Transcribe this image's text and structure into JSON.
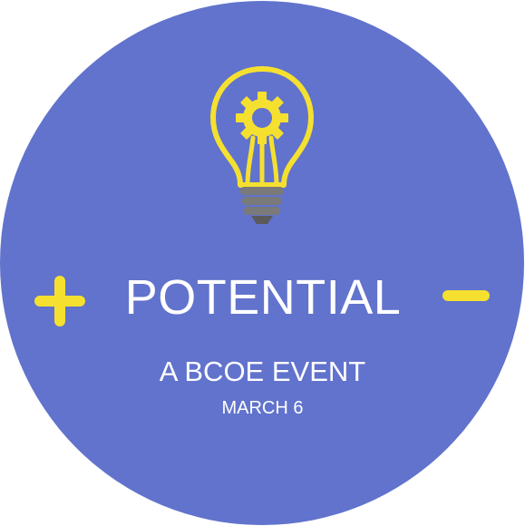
{
  "badge": {
    "title": "POTENTIAL",
    "subtitle": "A BCOE EVENT",
    "date": "MARCH 6",
    "icon": "lightbulb-gear-icon",
    "left_symbol": "plus-icon",
    "right_symbol": "minus-icon"
  },
  "colors": {
    "background_circle": "#6173cc",
    "accent_yellow": "#f5e030",
    "text": "#ffffff",
    "bulb_base": "#7a7a7a",
    "bulb_base_dark": "#5a5a5a"
  }
}
